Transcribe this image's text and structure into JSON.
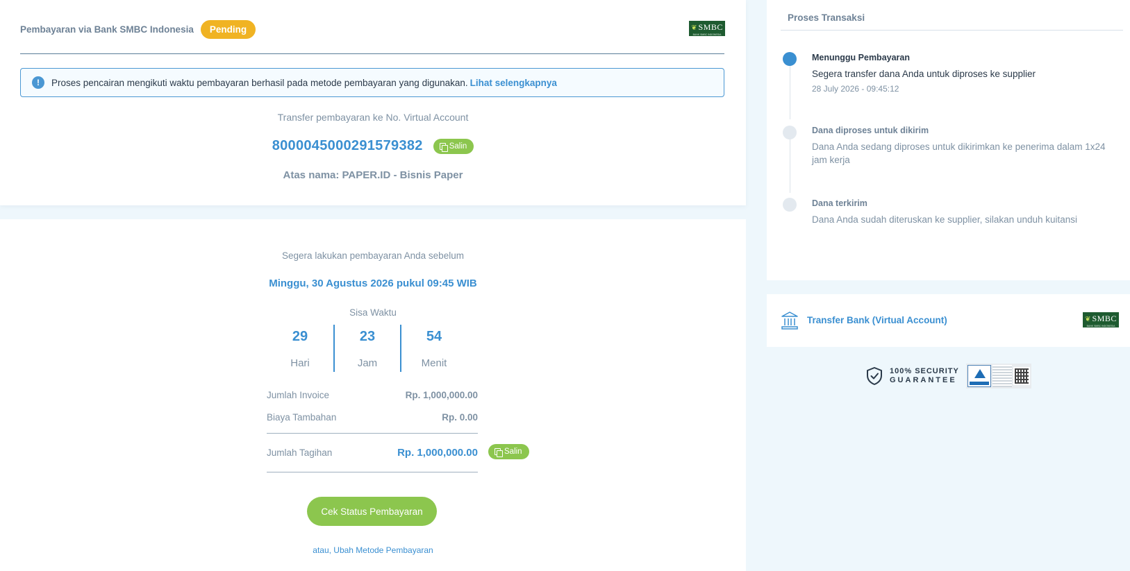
{
  "header": {
    "title": "Pembayaran via Bank SMBC Indonesia",
    "status_badge": "Pending",
    "bank_logo_text": "SMBC",
    "bank_logo_sub": "BANK SMBC INDONESIA"
  },
  "info": {
    "icon": "exclamation-icon",
    "text": "Proses pencairan mengikuti waktu pembayaran berhasil pada metode pembayaran yang digunakan.",
    "link": "Lihat selengkapnya"
  },
  "virtual_account": {
    "label": "Transfer pembayaran ke No. Virtual Account",
    "number": "8000045000291579382",
    "copy_label": "Salin",
    "account_name": "Atas nama: PAPER.ID - Bisnis Paper"
  },
  "deadline": {
    "label": "Segera lakukan pembayaran Anda sebelum",
    "date": "Minggu, 30 Agustus 2026 pukul 09:45 WIB",
    "remaining_label": "Sisa Waktu",
    "countdown": [
      {
        "value": "29",
        "unit": "Hari"
      },
      {
        "value": "23",
        "unit": "Jam"
      },
      {
        "value": "54",
        "unit": "Menit"
      }
    ]
  },
  "summary": {
    "invoice_label": "Jumlah Invoice",
    "invoice_value": "Rp. 1,000,000.00",
    "fee_label": "Biaya Tambahan",
    "fee_value": "Rp. 0.00",
    "total_label": "Jumlah Tagihan",
    "total_value": "Rp. 1,000,000.00",
    "copy_label": "Salin"
  },
  "actions": {
    "check_status": "Cek Status Pembayaran",
    "change_method": "atau, Ubah Metode Pembayaran"
  },
  "process": {
    "title": "Proses Transaksi",
    "steps": [
      {
        "title": "Menunggu Pembayaran",
        "desc": "Segera transfer dana Anda untuk diproses ke supplier",
        "time": "28 July 2026 - 09:45:12",
        "active": true
      },
      {
        "title": "Dana diproses untuk dikirim",
        "desc": "Dana Anda sedang diproses untuk dikirimkan ke penerima dalam 1x24 jam kerja",
        "active": false
      },
      {
        "title": "Dana terkirim",
        "desc": "Dana Anda sudah diteruskan ke supplier, silakan unduh kuitansi",
        "active": false
      }
    ]
  },
  "method": {
    "label": "Transfer Bank (Virtual Account)",
    "icon": "bank-icon"
  },
  "security": {
    "line1": "100% SECURITY",
    "line2": "GUARANTEE",
    "icon": "shield-check-icon"
  },
  "colors": {
    "accent": "#3a8fd1",
    "success": "#8cc64e",
    "pending": "#f0b323",
    "background": "#eef7fc"
  }
}
